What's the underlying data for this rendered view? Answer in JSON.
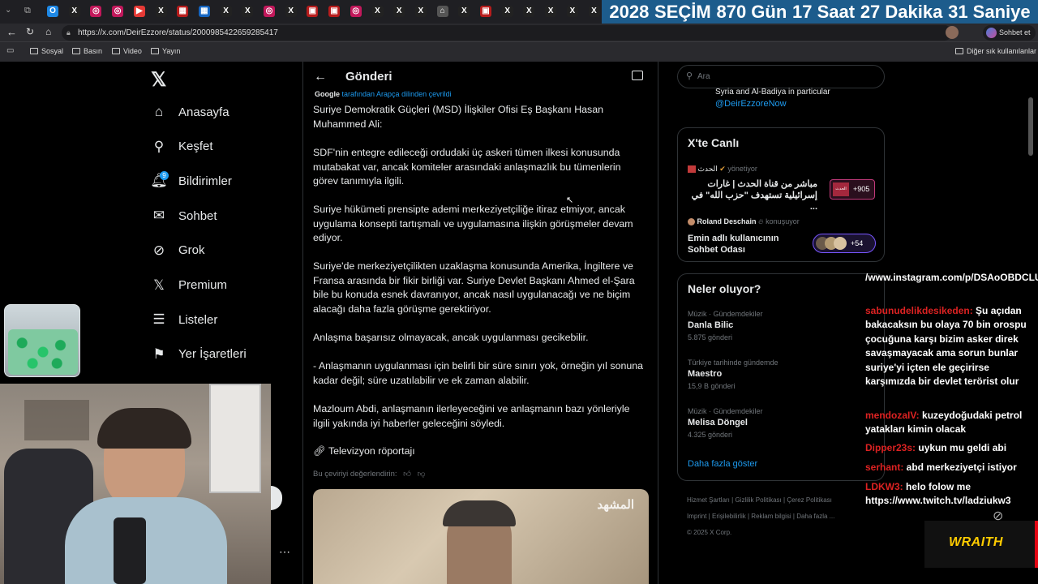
{
  "browser": {
    "tab_icons": [
      "O",
      "X",
      "◎",
      "◎",
      "▶",
      "X",
      "▦",
      "▦",
      "X",
      "X",
      "◎",
      "X",
      "▣",
      "▣",
      "◎",
      "X",
      "X",
      "X",
      "⌂",
      "X",
      "▣",
      "X",
      "X",
      "X",
      "X",
      "X"
    ],
    "url": "https://x.com/DeirEzzore/status/2000985422659285417",
    "chat_button": "Sohbet et",
    "bookmarks": [
      "Sosyal",
      "Basın",
      "Video",
      "Yayın"
    ],
    "other_bookmarks": "Diğer sık kullanılanlar"
  },
  "countdown": {
    "year": "2028",
    "label": "SEÇİM",
    "days": "870 Gün",
    "hours": "17 Saat",
    "minutes": "27 Dakika",
    "seconds": "31 Saniye"
  },
  "sidebar": {
    "items": [
      {
        "label": "Anasayfa",
        "icon": "home-icon",
        "glyph": "⌂"
      },
      {
        "label": "Keşfet",
        "icon": "search-icon",
        "glyph": "⚲"
      },
      {
        "label": "Bildirimler",
        "icon": "bell-icon",
        "glyph": "🔔︎"
      },
      {
        "label": "Sohbet",
        "icon": "mail-icon",
        "glyph": "✉"
      },
      {
        "label": "Grok",
        "icon": "grok-icon",
        "glyph": "⊘"
      },
      {
        "label": "Premium",
        "icon": "x-premium-icon",
        "glyph": "𝕏"
      },
      {
        "label": "Listeler",
        "icon": "list-icon",
        "glyph": "☰"
      },
      {
        "label": "Yer İşaretleri",
        "icon": "bookmark-icon",
        "glyph": "⚑"
      }
    ],
    "notification_count": "9"
  },
  "post": {
    "header": "Gönderi",
    "translated_by": "Google",
    "translated_note": "tarafından Arapça dilinden çevrildi",
    "paragraphs": [
      "Suriye Demokratik Güçleri (MSD) İlişkiler Ofisi Eş Başkanı Hasan Muhammed Ali:",
      "SDF'nin entegre edileceği ordudaki üç askeri tümen ilkesi konusunda mutabakat var, ancak komiteler arasındaki anlaşmazlık bu tümenlerin görev tanımıyla ilgili.",
      "Suriye hükümeti prensipte ademi merkeziyetçiliğe itiraz etmiyor, ancak uygulama konsepti tartışmalı ve uygulamasına ilişkin görüşmeler devam ediyor.",
      "Suriye'de merkeziyetçilikten uzaklaşma konusunda Amerika, İngiltere ve Fransa arasında bir fikir birliği var. Suriye Devlet Başkanı Ahmed el-Şara bile bu konuda esnek davranıyor, ancak nasıl uygulanacağı ve ne biçim alacağı daha fazla görüşme gerektiriyor.",
      "Anlaşma başarısız olmayacak, ancak uygulanması gecikebilir.",
      "- Anlaşmanın uygulanması için belirli bir süre sınırı yok, örneğin yıl sonuna kadar değil; süre uzatılabilir ve ek zaman alabilir.",
      "Mazloum Abdi, anlaşmanın ilerleyeceğini ve anlaşmanın bazı yönleriyle ilgili yakında iyi haberler geleceğini söyledi."
    ],
    "link_text": "Televizyon röportajı",
    "rate_translation": "Bu çeviriyi değerlendirin:",
    "video_watermark": "المشهد"
  },
  "search": {
    "placeholder": "Ara"
  },
  "top_snippet": {
    "text": "Syria and Al-Badiya in particular",
    "handle": "@DeirEzzoreNow"
  },
  "live": {
    "title": "X'te Canlı",
    "spaces": [
      {
        "host": "الحدث",
        "role": "yönetiyor",
        "title": "مباشر من قناة الحدث | غارات إسرائيلية تستهدف \"حزب الله\" في ...",
        "count": "+905",
        "thumb": "الحدث"
      },
      {
        "host": "Roland Deschain",
        "role": "konuşuyor",
        "title": "Emin adlı kullanıcının Sohbet Odası",
        "count": "+54"
      }
    ]
  },
  "trends": {
    "title": "Neler oluyor?",
    "items": [
      {
        "context": "Müzik · Gündemdekiler",
        "name": "Danla Bilic",
        "posts": "5.875 gönderi"
      },
      {
        "context": "Türkiye tarihinde gündemde",
        "name": "Maestro",
        "posts": "15,9 B gönderi"
      },
      {
        "context": "Müzik · Gündemdekiler",
        "name": "Melisa Döngel",
        "posts": "4.325 gönderi"
      }
    ],
    "show_more": "Daha fazla göster"
  },
  "footer": {
    "links": [
      "Hizmet Şartları",
      "Gizlilik Politikası",
      "Çerez Politikası",
      "Imprint",
      "Erişilebilirlik",
      "Reklam bilgisi",
      "Daha fazla ..."
    ],
    "copyright": "© 2025 X Corp."
  },
  "chat": [
    {
      "user": "",
      "msg": "/www.instagram.com/p/DSAoOBDCLUo/"
    },
    {
      "user": "sabunudelikdesikeden:",
      "msg": " Şu açıdan bakacaksın bu olaya 70 bin orospu çocuğuna karşı bizim asker direk savaşmayacak ama sorun bunlar suriye'yi içten ele geçirirse karşımızda bir devlet terörist olur"
    },
    {
      "user": "mendozaIV:",
      "msg": " kuzeydoğudaki petrol yatakları kimin olacak"
    },
    {
      "user": "Dipper23s:",
      "msg": " uykun mu geldi abi"
    },
    {
      "user": "serhant:",
      "msg": " abd merkeziyetçi istiyor"
    },
    {
      "user": "LDKW3:",
      "msg": " helo folow me https://www.twitch.tv/ladziukw3"
    }
  ],
  "overlay": {
    "brand": "WRAITH"
  },
  "colors": {
    "accent": "#1d9bf0",
    "border": "#2f3336",
    "countdown_bg": "#1d5c8c",
    "brand": "#e30613"
  }
}
